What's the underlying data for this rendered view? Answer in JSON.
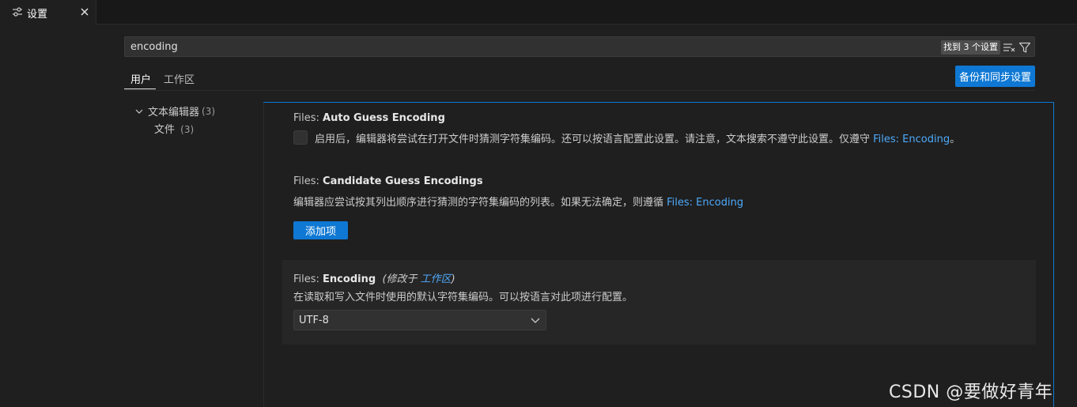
{
  "tab": {
    "title": "设置",
    "icon": "settings-sliders-icon",
    "close_icon": "close-icon"
  },
  "search": {
    "value": "encoding",
    "results_badge": "找到 3 个设置",
    "clear_icon": "clear-filter-icon",
    "filter_icon": "filter-icon"
  },
  "scopes": {
    "user": "用户",
    "workspace": "工作区",
    "active": "用户"
  },
  "sync_button": "备份和同步设置",
  "toc": {
    "group": {
      "label": "文本编辑器",
      "count": "(3)",
      "expanded": true
    },
    "child": {
      "label": "文件",
      "count": "(3)"
    }
  },
  "settings": [
    {
      "category": "Files: ",
      "name": "Auto Guess Encoding",
      "description": "启用后，编辑器将尝试在打开文件时猜测字符集编码。还可以按语言配置此设置。请注意，文本搜索不遵守此设置。仅遵守 ",
      "link": "Files: Encoding",
      "suffix": "。",
      "checked": false
    },
    {
      "category": "Files: ",
      "name": "Candidate Guess Encodings",
      "description": "编辑器应尝试按其列出顺序进行猜测的字符集编码的列表。如果无法确定，则遵循 ",
      "link": "Files: Encoding",
      "button": "添加项"
    },
    {
      "category": "Files: ",
      "name": "Encoding",
      "modified_prefix": "(修改于 ",
      "modified_link": "工作区",
      "modified_suffix": ")",
      "description": "在读取和写入文件时使用的默认字符集编码。可以按语言对此项进行配置。",
      "value": "UTF-8"
    }
  ],
  "watermark": "CSDN @要做好青年",
  "colors": {
    "accent": "#0e78d4",
    "link": "#4daafc",
    "background": "#1f1f1f"
  }
}
